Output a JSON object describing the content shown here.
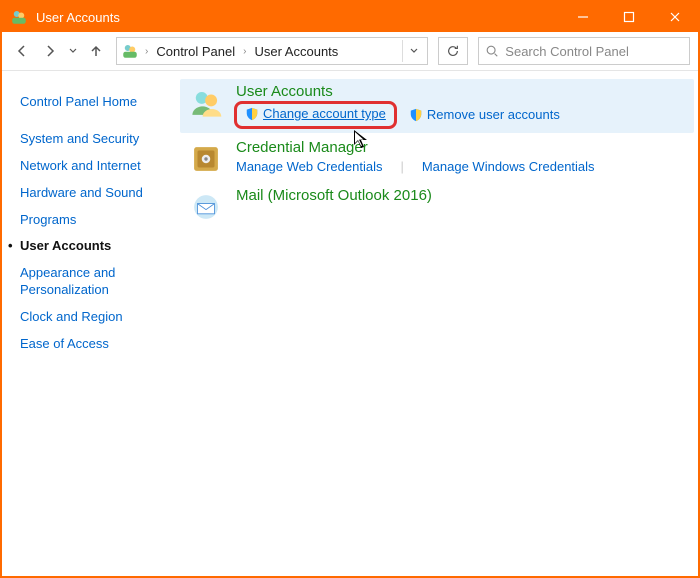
{
  "titlebar": {
    "title": "User Accounts"
  },
  "breadcrumb": {
    "part1": "Control Panel",
    "part2": "User Accounts"
  },
  "search": {
    "placeholder": "Search Control Panel"
  },
  "sidebar": {
    "home": "Control Panel Home",
    "items": [
      "System and Security",
      "Network and Internet",
      "Hardware and Sound",
      "Programs",
      "User Accounts",
      "Appearance and Personalization",
      "Clock and Region",
      "Ease of Access"
    ],
    "activeIndex": 4
  },
  "sections": {
    "userAccounts": {
      "title": "User Accounts",
      "changeType": "Change account type",
      "remove": "Remove user accounts"
    },
    "credential": {
      "title": "Credential Manager",
      "web": "Manage Web Credentials",
      "win": "Manage Windows Credentials"
    },
    "mail": {
      "title": "Mail (Microsoft Outlook 2016)"
    }
  }
}
